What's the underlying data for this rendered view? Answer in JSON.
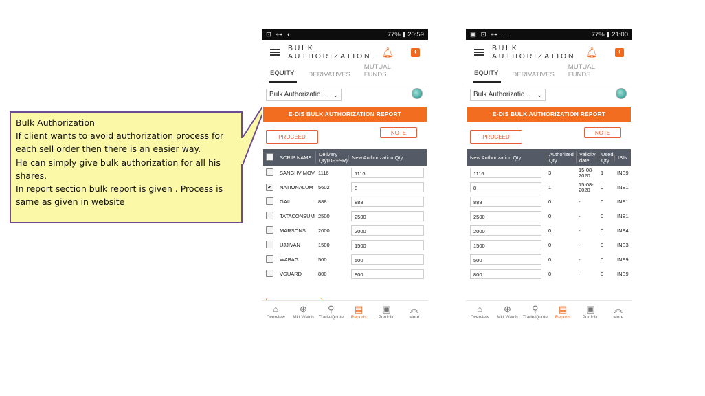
{
  "callout": {
    "lines": [
      "Bulk Authorization",
      "If client wants to avoid authorization process for",
      "each sell order then there  is an easier way.",
      "He can simply  give bulk authorization for all his",
      "shares.",
      "In report section bulk report is given . Process is",
      "same as given in website"
    ]
  },
  "colors": {
    "accent": "#f26d1f",
    "table_header": "#555b66",
    "callout_bg": "#fbf8a8",
    "callout_border": "#6f4c8f"
  },
  "phone1": {
    "status": {
      "left_icons": "⊡ ⊶ ◐",
      "right": "77% ▮ 20:59"
    },
    "title_line1": "BULK",
    "title_line2": "AUTHORIZATION",
    "tabs": [
      "EQUITY",
      "DERIVATIVES",
      "MUTUAL FUNDS"
    ],
    "select_value": "Bulk Authorizatio...",
    "banner": "E-DIS BULK AUTHORIZATION REPORT",
    "proceed": "PROCEED",
    "note": "NOTE",
    "headers": [
      "SCRIP NAME",
      "Delivery Qty(DP+SR)",
      "New Authorization Qty"
    ],
    "rows": [
      {
        "checked": false,
        "scrip": "SANGHVIMOV",
        "qty": "1116",
        "auth": "1116"
      },
      {
        "checked": true,
        "scrip": "NATIONALUM",
        "qty": "5602",
        "auth": "8"
      },
      {
        "checked": false,
        "scrip": "GAIL",
        "qty": "888",
        "auth": "888"
      },
      {
        "checked": false,
        "scrip": "TATACONSUM",
        "qty": "2500",
        "auth": "2500"
      },
      {
        "checked": false,
        "scrip": "MARSONS",
        "qty": "2000",
        "auth": "2000"
      },
      {
        "checked": false,
        "scrip": "UJJIVAN",
        "qty": "1500",
        "auth": "1500"
      },
      {
        "checked": false,
        "scrip": "WABAG",
        "qty": "500",
        "auth": "500"
      },
      {
        "checked": false,
        "scrip": "VGUARD",
        "qty": "800",
        "auth": "800"
      }
    ],
    "nav": [
      "Overview",
      "Mkt Watch",
      "Trade/Quote",
      "Reports",
      "Portfolio",
      "More"
    ]
  },
  "phone2": {
    "status": {
      "left_icons": "▣ ⊡ ⊶ ...",
      "right": "77% ▮ 21:00"
    },
    "title_line1": "BULK",
    "title_line2": "AUTHORIZATION",
    "tabs": [
      "EQUITY",
      "DERIVATIVES",
      "MUTUAL FUNDS"
    ],
    "select_value": "Bulk Authorizatio...",
    "banner": "E-DIS BULK AUTHORIZATION REPORT",
    "proceed": "PROCEED",
    "note": "NOTE",
    "headers": [
      "New Authorization Qty",
      "Authorized Qty",
      "Validity date",
      "Used Qty",
      "ISIN"
    ],
    "rows": [
      {
        "auth": "1116",
        "authorized": "3",
        "validity": "15-08-2020",
        "used": "1",
        "isin": "INE9"
      },
      {
        "auth": "8",
        "authorized": "1",
        "validity": "15-08-2020",
        "used": "0",
        "isin": "INE1"
      },
      {
        "auth": "888",
        "authorized": "0",
        "validity": "-",
        "used": "0",
        "isin": "INE1"
      },
      {
        "auth": "2500",
        "authorized": "0",
        "validity": "-",
        "used": "0",
        "isin": "INE1"
      },
      {
        "auth": "2000",
        "authorized": "0",
        "validity": "-",
        "used": "0",
        "isin": "INE4"
      },
      {
        "auth": "1500",
        "authorized": "0",
        "validity": "-",
        "used": "0",
        "isin": "INE3"
      },
      {
        "auth": "500",
        "authorized": "0",
        "validity": "-",
        "used": "0",
        "isin": "INE9"
      },
      {
        "auth": "800",
        "authorized": "0",
        "validity": "-",
        "used": "0",
        "isin": "INE9"
      }
    ],
    "nav": [
      "Overview",
      "Mkt Watch",
      "Trade/Quote",
      "Reports",
      "Portfolio",
      "More"
    ]
  }
}
